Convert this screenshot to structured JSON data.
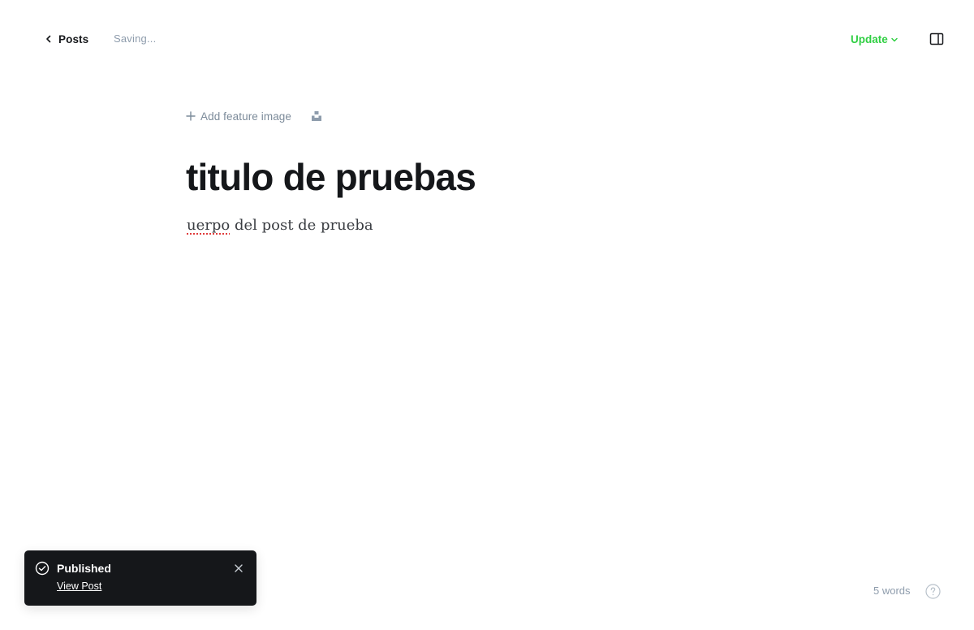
{
  "header": {
    "back_label": "Posts",
    "status": "Saving...",
    "update_label": "Update"
  },
  "editor": {
    "feature_image_label": "Add feature image",
    "title": "titulo de pruebas",
    "body_misspelled": "uerpo",
    "body_rest": " del post de prueba"
  },
  "notification": {
    "title": "Published",
    "link": "View Post"
  },
  "footer": {
    "word_count": "5 words"
  },
  "colors": {
    "accent_green": "#30cf43",
    "toast_bg": "#15171a",
    "muted_text": "#8e9cac",
    "spellcheck_red": "#e03b3b"
  },
  "icons": [
    "chevron-left-icon",
    "chevron-down-icon",
    "sidebar-toggle-icon",
    "plus-icon",
    "unsplash-icon",
    "check-circle-icon",
    "close-icon",
    "question-icon"
  ]
}
